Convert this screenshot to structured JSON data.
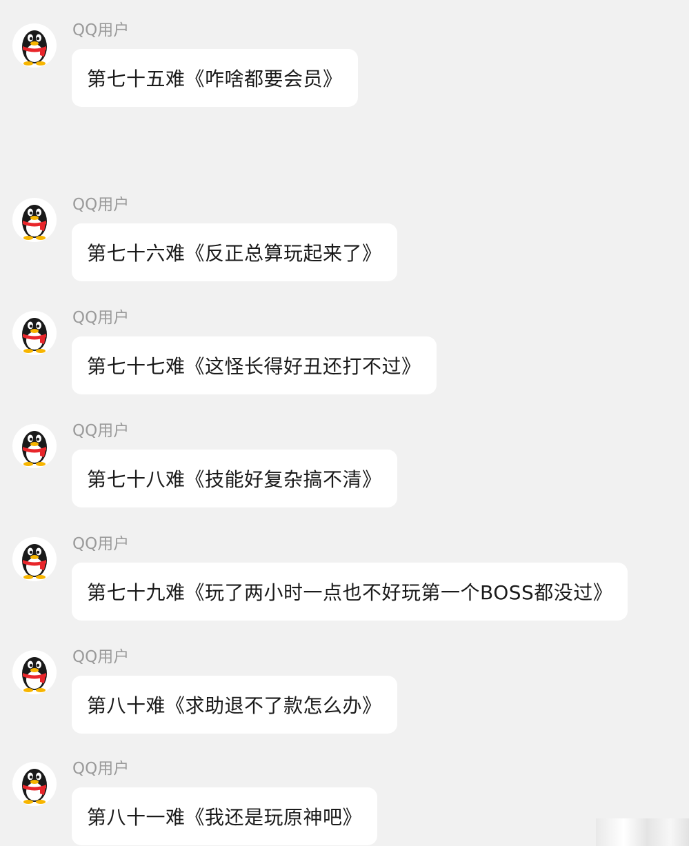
{
  "messages": [
    {
      "sender": "QQ用户",
      "text": "第七十五难《咋啥都要会员》"
    },
    {
      "sender": "QQ用户",
      "text": "第七十六难《反正总算玩起来了》"
    },
    {
      "sender": "QQ用户",
      "text": "第七十七难《这怪长得好丑还打不过》"
    },
    {
      "sender": "QQ用户",
      "text": "第七十八难《技能好复杂搞不清》"
    },
    {
      "sender": "QQ用户",
      "text": "第七十九难《玩了两小时一点也不好玩第一个BOSS都没过》"
    },
    {
      "sender": "QQ用户",
      "text": "第八十难《求助退不了款怎么办》"
    },
    {
      "sender": "QQ用户",
      "text": "第八十一难《我还是玩原神吧》"
    }
  ],
  "avatar_icon": "qq-penguin-icon",
  "colors": {
    "background": "#f1f1f1",
    "bubble": "#ffffff",
    "sender_text": "#9a9a9a",
    "message_text": "#1a1a1a",
    "scarf": "#e8262b"
  }
}
